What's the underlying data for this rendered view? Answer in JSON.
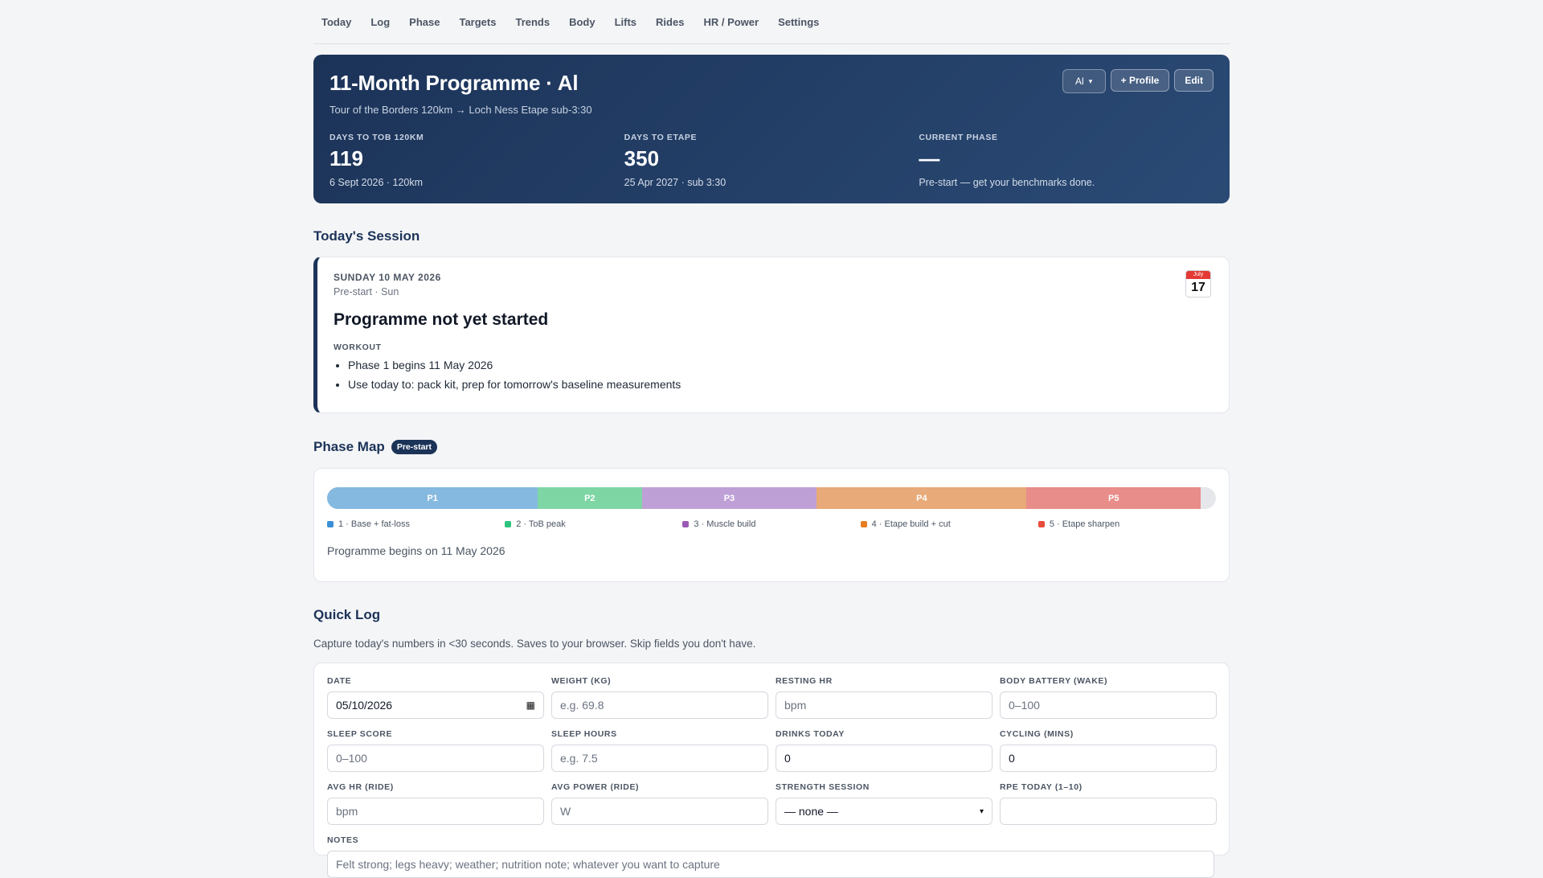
{
  "nav": [
    "Today",
    "Log",
    "Phase",
    "Targets",
    "Trends",
    "Body",
    "Lifts",
    "Rides",
    "HR / Power",
    "Settings"
  ],
  "hero": {
    "title": "11-Month Programme · Al",
    "subtitle": "Tour of the Borders 120km → Loch Ness Etape sub-3:30",
    "profile_select": "Al",
    "add_profile": "+ Profile",
    "edit": "Edit",
    "stats": [
      {
        "label": "DAYS TO TOB 120KM",
        "value": "119",
        "meta": "6 Sept 2026 · 120km"
      },
      {
        "label": "DAYS TO ETAPE",
        "value": "350",
        "meta": "25 Apr 2027 · sub 3:30"
      },
      {
        "label": "CURRENT PHASE",
        "value": "—",
        "meta": "Pre-start — get your benchmarks done."
      }
    ]
  },
  "session": {
    "heading": "Today's Session",
    "date": "SUNDAY 10 MAY 2026",
    "phase": "Pre-start · Sun",
    "title": "Programme not yet started",
    "workout_label": "WORKOUT",
    "items": [
      "Phase 1 begins 11 May 2026",
      "Use today to: pack kit, prep for tomorrow's baseline measurements"
    ],
    "calendar": {
      "month": "July",
      "day": "17",
      "icon": "calendar-icon"
    }
  },
  "phase_map": {
    "heading": "Phase Map",
    "badge": "Pre-start",
    "segments": [
      {
        "label": "P1",
        "fraction": 0.237,
        "color": "#85b9e0"
      },
      {
        "label": "P2",
        "fraction": 0.117,
        "color": "#7fd6a5"
      },
      {
        "label": "P3",
        "fraction": 0.197,
        "color": "#bfa0d6"
      },
      {
        "label": "P4",
        "fraction": 0.236,
        "color": "#e8aa78"
      },
      {
        "label": "P5",
        "fraction": 0.196,
        "color": "#e88d8a"
      }
    ],
    "legend": [
      {
        "label": "1 · Base + fat-loss",
        "color": "#3b8fd4"
      },
      {
        "label": "2 · ToB peak",
        "color": "#2ec27e"
      },
      {
        "label": "3 · Muscle build",
        "color": "#9b59b6"
      },
      {
        "label": "4 · Etape build + cut",
        "color": "#e67e22"
      },
      {
        "label": "5 · Etape sharpen",
        "color": "#e74c3c"
      }
    ],
    "note": "Programme begins on 11 May 2026"
  },
  "quick_log": {
    "heading": "Quick Log",
    "subtitle": "Capture today's numbers in <30 seconds. Saves to your browser. Skip fields you don't have.",
    "fields": [
      {
        "label": "DATE",
        "value": "05/10/2026",
        "placeholder": ""
      },
      {
        "label": "WEIGHT (KG)",
        "value": "",
        "placeholder": "e.g. 69.8"
      },
      {
        "label": "RESTING HR",
        "value": "",
        "placeholder": "bpm"
      },
      {
        "label": "BODY BATTERY (WAKE)",
        "value": "",
        "placeholder": "0–100"
      },
      {
        "label": "SLEEP SCORE",
        "value": "",
        "placeholder": "0–100"
      },
      {
        "label": "SLEEP HOURS",
        "value": "",
        "placeholder": "e.g. 7.5"
      },
      {
        "label": "DRINKS TODAY",
        "value": "0",
        "placeholder": ""
      },
      {
        "label": "CYCLING (MINS)",
        "value": "0",
        "placeholder": ""
      },
      {
        "label": "AVG HR (RIDE)",
        "value": "",
        "placeholder": "bpm"
      },
      {
        "label": "AVG POWER (RIDE)",
        "value": "",
        "placeholder": "W"
      },
      {
        "label": "STRENGTH SESSION",
        "value": "— none —",
        "placeholder": ""
      },
      {
        "label": "RPE TODAY (1–10)",
        "value": "",
        "placeholder": ""
      }
    ],
    "notes_label": "NOTES",
    "notes_placeholder": "Felt strong; legs heavy; weather; nutrition note; whatever you want to capture"
  }
}
